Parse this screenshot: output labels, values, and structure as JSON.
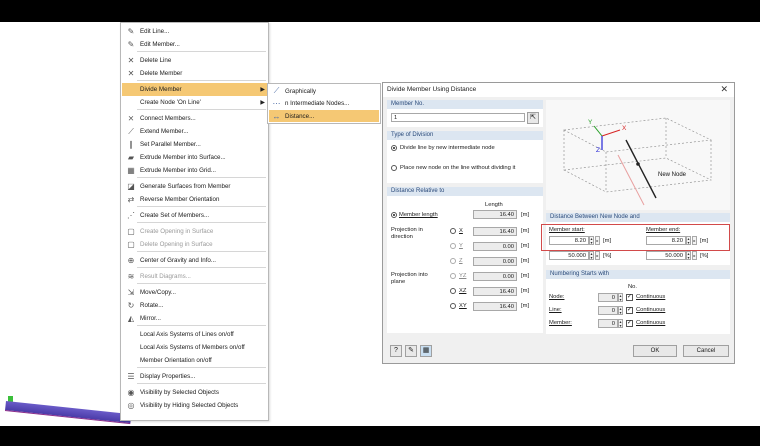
{
  "menu": {
    "items": [
      {
        "label": "Edit Line...",
        "icon": "edit-line-icon"
      },
      {
        "label": "Edit Member...",
        "icon": "edit-member-icon"
      },
      {
        "label": "Delete Line",
        "icon": "delete-line-icon"
      },
      {
        "label": "Delete Member",
        "icon": "delete-member-icon"
      },
      {
        "label": "Divide Member",
        "icon": "",
        "submenu": true,
        "highlighted": true
      },
      {
        "label": "Create Node 'On Line'",
        "icon": "",
        "submenu": true
      },
      {
        "label": "Connect Members...",
        "icon": "connect-members-icon"
      },
      {
        "label": "Extend Member...",
        "icon": "extend-member-icon"
      },
      {
        "label": "Set Parallel Member...",
        "icon": "parallel-member-icon"
      },
      {
        "label": "Extrude Member into Surface...",
        "icon": "extrude-surface-icon"
      },
      {
        "label": "Extrude Member into Grid...",
        "icon": "extrude-grid-icon"
      },
      {
        "label": "Generate Surfaces from Member",
        "icon": "generate-surfaces-icon"
      },
      {
        "label": "Reverse Member Orientation",
        "icon": "reverse-orientation-icon"
      },
      {
        "label": "Create Set of Members...",
        "icon": "set-of-members-icon"
      },
      {
        "label": "Create Opening in Surface",
        "icon": "opening-icon",
        "disabled": true
      },
      {
        "label": "Delete Opening in Surface",
        "icon": "delete-opening-icon",
        "disabled": true
      },
      {
        "label": "Center of Gravity and Info...",
        "icon": "center-gravity-icon"
      },
      {
        "label": "Result Diagrams...",
        "icon": "result-diagrams-icon",
        "disabled": true
      },
      {
        "label": "Move/Copy...",
        "icon": "move-copy-icon"
      },
      {
        "label": "Rotate...",
        "icon": "rotate-icon"
      },
      {
        "label": "Mirror...",
        "icon": "mirror-icon"
      },
      {
        "label": "Local Axis Systems of Lines on/off",
        "icon": ""
      },
      {
        "label": "Local Axis Systems of Members on/off",
        "icon": ""
      },
      {
        "label": "Member Orientation on/off",
        "icon": ""
      },
      {
        "label": "Display Properties...",
        "icon": "display-properties-icon"
      },
      {
        "label": "Visibility by Selected Objects",
        "icon": "visibility-selected-icon"
      },
      {
        "label": "Visibility by Hiding Selected Objects",
        "icon": "visibility-hiding-icon"
      }
    ]
  },
  "submenu": {
    "items": [
      {
        "label": "Graphically",
        "icon": "graphically-icon"
      },
      {
        "label": "n Intermediate Nodes...",
        "icon": "intermediate-nodes-icon"
      },
      {
        "label": "Distance...",
        "icon": "distance-icon",
        "highlighted": true
      }
    ]
  },
  "dialog": {
    "title": "Divide Member Using Distance",
    "member_no_label": "Member No.",
    "member_no_value": "1",
    "type_of_division_label": "Type of Division",
    "option_divide": "Divide line by new intermediate node",
    "option_place": "Place new node on the line without dividing it",
    "distance_relative_label": "Distance Relative to",
    "length_header": "Length",
    "member_length_label": "Member length",
    "member_length_value": "16.40",
    "unit_m": "[m]",
    "unit_pct": "[%]",
    "projection_direction_label": "Projection in direction",
    "proj_dir": [
      {
        "axis": "X",
        "value": "16.40"
      },
      {
        "axis": "Y",
        "value": "0.00"
      },
      {
        "axis": "Z",
        "value": "0.00"
      }
    ],
    "projection_plane_label": "Projection into plane",
    "proj_plane": [
      {
        "axis": "YZ",
        "value": "0.00"
      },
      {
        "axis": "XZ",
        "value": "16.40"
      },
      {
        "axis": "XY",
        "value": "16.40"
      }
    ],
    "image_labels": {
      "y": "Y",
      "x": "X",
      "z": "Z",
      "new_node": "New Node"
    },
    "distance_between_label": "Distance Between New Node and",
    "member_start_label": "Member start:",
    "member_end_label": "Member end:",
    "start_m": "8.20",
    "end_m": "8.20",
    "start_pct": "50.000",
    "end_pct": "50.000",
    "numbering_label": "Numbering Starts with",
    "no_header": "No.",
    "numbering_rows": [
      {
        "label": "Node:",
        "value": "0",
        "check": "Continuous"
      },
      {
        "label": "Line:",
        "value": "0",
        "check": "Continuous"
      },
      {
        "label": "Member:",
        "value": "0",
        "check": "Continuous"
      }
    ],
    "ok_label": "OK",
    "cancel_label": "Cancel",
    "close_glyph": "✕"
  }
}
